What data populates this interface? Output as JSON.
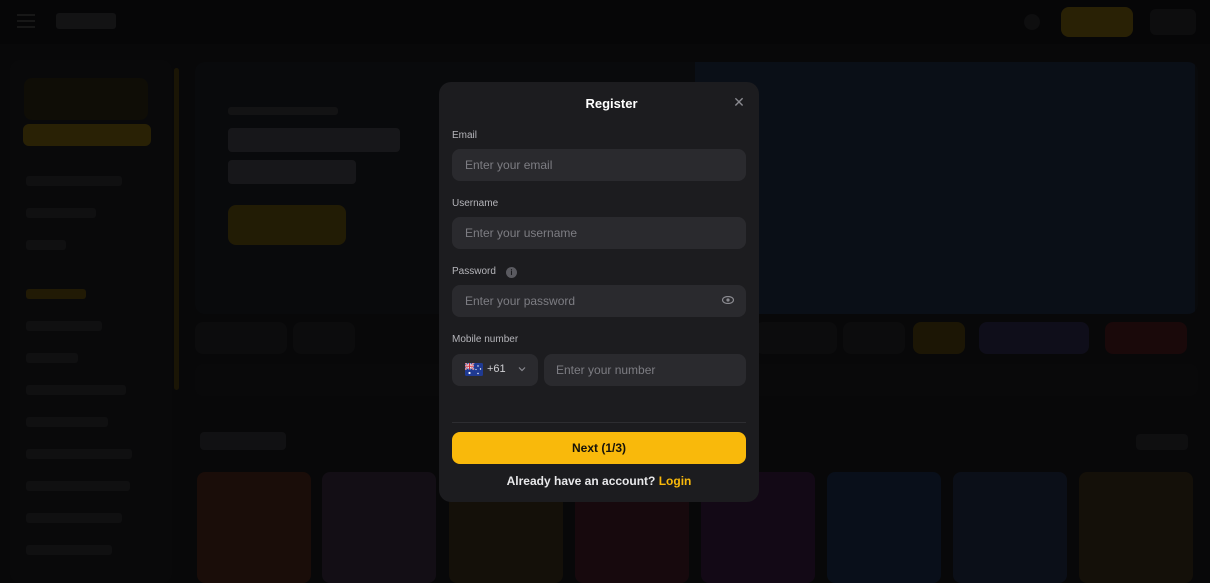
{
  "modal": {
    "title": "Register",
    "close_icon": "close-icon",
    "email": {
      "label": "Email",
      "placeholder": "Enter your email"
    },
    "username": {
      "label": "Username",
      "placeholder": "Enter your username"
    },
    "password": {
      "label": "Password",
      "placeholder": "Enter your password",
      "info_icon": "info-icon",
      "toggle_icon": "eye-icon"
    },
    "mobile": {
      "label": "Mobile number",
      "country_code": "+61",
      "country_flag": "australia-flag-icon",
      "placeholder": "Enter your number"
    },
    "next_button": "Next (1/3)",
    "login_prompt": "Already have an account?",
    "login_link": "Login"
  },
  "colors": {
    "accent": "#f9b90b",
    "modal_bg": "#1c1c1f",
    "input_bg": "#2a2a2e"
  }
}
